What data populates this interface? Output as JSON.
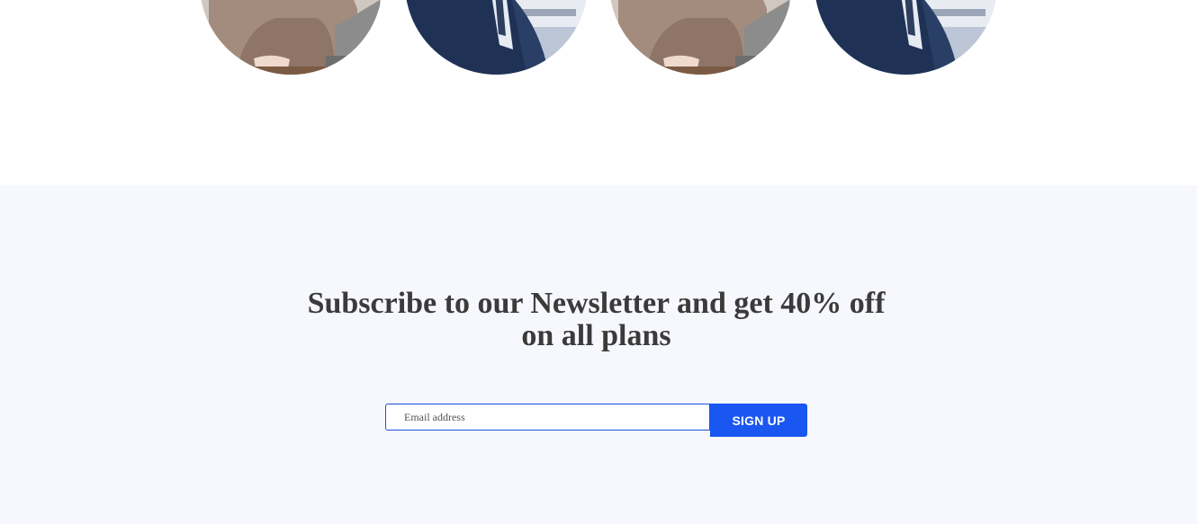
{
  "team": {
    "members": [
      {
        "photo": "woman-hijab-laptop-photo"
      },
      {
        "photo": "man-suit-office-photo"
      },
      {
        "photo": "woman-hijab-laptop-photo"
      },
      {
        "photo": "man-suit-office-photo"
      }
    ]
  },
  "newsletter": {
    "title": "Subscribe to our Newsletter and get 40% off on all plans",
    "email_placeholder": "Email address",
    "email_value": "",
    "signup_label": "SIGN UP"
  },
  "colors": {
    "accent": "#1a56f0",
    "section_bg": "#f7f8fd",
    "title_text": "#3b3b3b"
  }
}
